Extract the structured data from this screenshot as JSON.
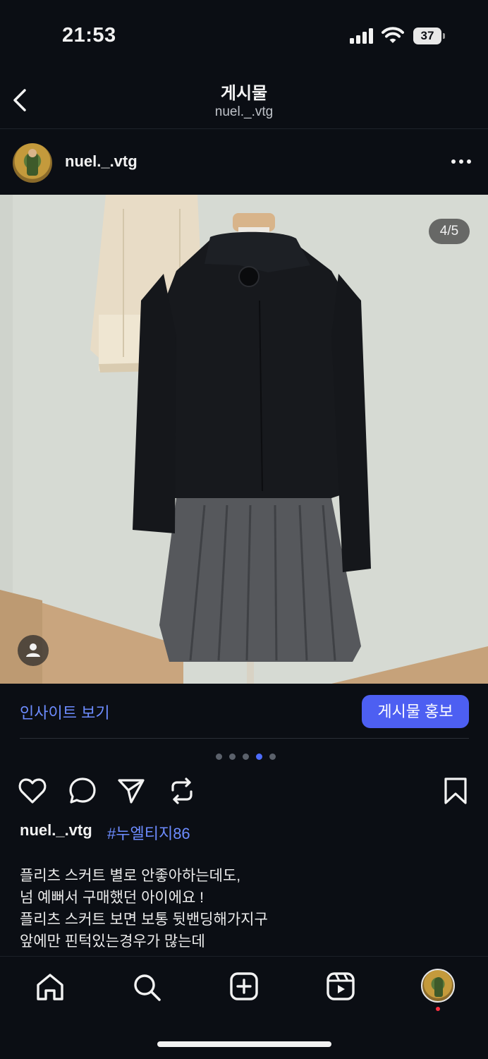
{
  "status": {
    "time": "21:53",
    "battery": "37"
  },
  "header": {
    "title": "게시물",
    "subtitle": "nuel._.vtg"
  },
  "post": {
    "username": "nuel._.vtg",
    "image_counter": "4/5",
    "carousel": {
      "count": 5,
      "active_index": 3
    }
  },
  "insights": {
    "link_label": "인사이트 보기",
    "promote_label": "게시물 홍보"
  },
  "caption": {
    "username": "nuel._.vtg",
    "hashtag": "#누엘티지86",
    "lines": [
      "플리츠 스커트 별로 안좋아하는데도,",
      "넘 예뻐서 구매했던 아이에요 !",
      "플리츠 스커트 보면 보통 뒷밴딩해가지구",
      "앞에만 핀턱있는경우가 많는데"
    ]
  },
  "colors": {
    "accent": "#4d5ff2",
    "link": "#6d8cff",
    "background": "#0b0e14",
    "notification": "#ff3040"
  },
  "icons": {
    "actions": [
      "heart-icon",
      "comment-icon",
      "share-icon",
      "repost-icon",
      "bookmark-icon"
    ],
    "tabs": [
      "home-icon",
      "search-icon",
      "create-icon",
      "reels-icon",
      "profile-avatar"
    ]
  }
}
